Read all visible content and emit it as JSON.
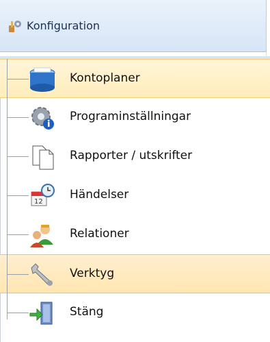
{
  "header": {
    "title": "Konfiguration",
    "icon": "config-tools-icon"
  },
  "items": [
    {
      "label": "Kontoplaner",
      "icon": "folder-box-icon"
    },
    {
      "label": "Programinställningar",
      "icon": "gear-info-icon"
    },
    {
      "label": "Rapporter / utskrifter",
      "icon": "documents-icon"
    },
    {
      "label": "Händelser",
      "icon": "calendar-clock-icon"
    },
    {
      "label": "Relationer",
      "icon": "people-icon"
    },
    {
      "label": "Verktyg",
      "icon": "wrench-icon"
    },
    {
      "label": "Stäng",
      "icon": "exit-door-icon"
    }
  ],
  "colors": {
    "header_bg": "#d6e5f6",
    "selected_bg": "#fff5d8",
    "hover_bg": "#ffe5b0"
  }
}
